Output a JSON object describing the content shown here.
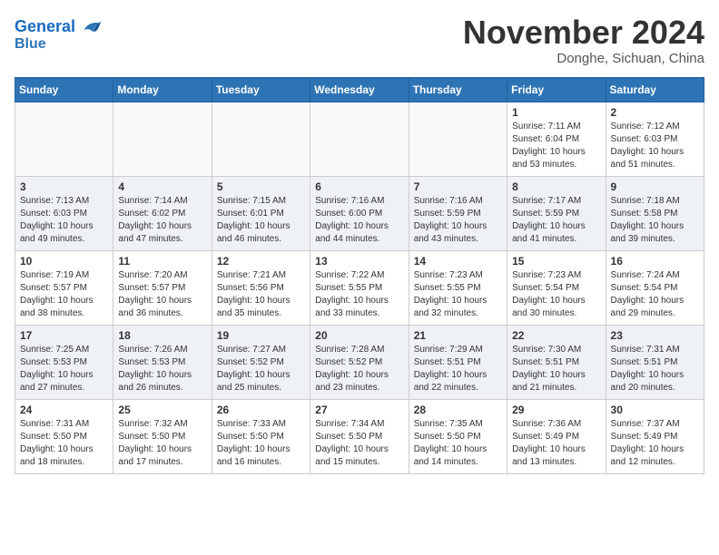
{
  "header": {
    "logo_line1": "General",
    "logo_line2": "Blue",
    "month_title": "November 2024",
    "location": "Donghe, Sichuan, China"
  },
  "weekdays": [
    "Sunday",
    "Monday",
    "Tuesday",
    "Wednesday",
    "Thursday",
    "Friday",
    "Saturday"
  ],
  "weeks": [
    [
      {
        "day": "",
        "info": ""
      },
      {
        "day": "",
        "info": ""
      },
      {
        "day": "",
        "info": ""
      },
      {
        "day": "",
        "info": ""
      },
      {
        "day": "",
        "info": ""
      },
      {
        "day": "1",
        "info": "Sunrise: 7:11 AM\nSunset: 6:04 PM\nDaylight: 10 hours and 53 minutes."
      },
      {
        "day": "2",
        "info": "Sunrise: 7:12 AM\nSunset: 6:03 PM\nDaylight: 10 hours and 51 minutes."
      }
    ],
    [
      {
        "day": "3",
        "info": "Sunrise: 7:13 AM\nSunset: 6:03 PM\nDaylight: 10 hours and 49 minutes."
      },
      {
        "day": "4",
        "info": "Sunrise: 7:14 AM\nSunset: 6:02 PM\nDaylight: 10 hours and 47 minutes."
      },
      {
        "day": "5",
        "info": "Sunrise: 7:15 AM\nSunset: 6:01 PM\nDaylight: 10 hours and 46 minutes."
      },
      {
        "day": "6",
        "info": "Sunrise: 7:16 AM\nSunset: 6:00 PM\nDaylight: 10 hours and 44 minutes."
      },
      {
        "day": "7",
        "info": "Sunrise: 7:16 AM\nSunset: 5:59 PM\nDaylight: 10 hours and 43 minutes."
      },
      {
        "day": "8",
        "info": "Sunrise: 7:17 AM\nSunset: 5:59 PM\nDaylight: 10 hours and 41 minutes."
      },
      {
        "day": "9",
        "info": "Sunrise: 7:18 AM\nSunset: 5:58 PM\nDaylight: 10 hours and 39 minutes."
      }
    ],
    [
      {
        "day": "10",
        "info": "Sunrise: 7:19 AM\nSunset: 5:57 PM\nDaylight: 10 hours and 38 minutes."
      },
      {
        "day": "11",
        "info": "Sunrise: 7:20 AM\nSunset: 5:57 PM\nDaylight: 10 hours and 36 minutes."
      },
      {
        "day": "12",
        "info": "Sunrise: 7:21 AM\nSunset: 5:56 PM\nDaylight: 10 hours and 35 minutes."
      },
      {
        "day": "13",
        "info": "Sunrise: 7:22 AM\nSunset: 5:55 PM\nDaylight: 10 hours and 33 minutes."
      },
      {
        "day": "14",
        "info": "Sunrise: 7:23 AM\nSunset: 5:55 PM\nDaylight: 10 hours and 32 minutes."
      },
      {
        "day": "15",
        "info": "Sunrise: 7:23 AM\nSunset: 5:54 PM\nDaylight: 10 hours and 30 minutes."
      },
      {
        "day": "16",
        "info": "Sunrise: 7:24 AM\nSunset: 5:54 PM\nDaylight: 10 hours and 29 minutes."
      }
    ],
    [
      {
        "day": "17",
        "info": "Sunrise: 7:25 AM\nSunset: 5:53 PM\nDaylight: 10 hours and 27 minutes."
      },
      {
        "day": "18",
        "info": "Sunrise: 7:26 AM\nSunset: 5:53 PM\nDaylight: 10 hours and 26 minutes."
      },
      {
        "day": "19",
        "info": "Sunrise: 7:27 AM\nSunset: 5:52 PM\nDaylight: 10 hours and 25 minutes."
      },
      {
        "day": "20",
        "info": "Sunrise: 7:28 AM\nSunset: 5:52 PM\nDaylight: 10 hours and 23 minutes."
      },
      {
        "day": "21",
        "info": "Sunrise: 7:29 AM\nSunset: 5:51 PM\nDaylight: 10 hours and 22 minutes."
      },
      {
        "day": "22",
        "info": "Sunrise: 7:30 AM\nSunset: 5:51 PM\nDaylight: 10 hours and 21 minutes."
      },
      {
        "day": "23",
        "info": "Sunrise: 7:31 AM\nSunset: 5:51 PM\nDaylight: 10 hours and 20 minutes."
      }
    ],
    [
      {
        "day": "24",
        "info": "Sunrise: 7:31 AM\nSunset: 5:50 PM\nDaylight: 10 hours and 18 minutes."
      },
      {
        "day": "25",
        "info": "Sunrise: 7:32 AM\nSunset: 5:50 PM\nDaylight: 10 hours and 17 minutes."
      },
      {
        "day": "26",
        "info": "Sunrise: 7:33 AM\nSunset: 5:50 PM\nDaylight: 10 hours and 16 minutes."
      },
      {
        "day": "27",
        "info": "Sunrise: 7:34 AM\nSunset: 5:50 PM\nDaylight: 10 hours and 15 minutes."
      },
      {
        "day": "28",
        "info": "Sunrise: 7:35 AM\nSunset: 5:50 PM\nDaylight: 10 hours and 14 minutes."
      },
      {
        "day": "29",
        "info": "Sunrise: 7:36 AM\nSunset: 5:49 PM\nDaylight: 10 hours and 13 minutes."
      },
      {
        "day": "30",
        "info": "Sunrise: 7:37 AM\nSunset: 5:49 PM\nDaylight: 10 hours and 12 minutes."
      }
    ]
  ]
}
